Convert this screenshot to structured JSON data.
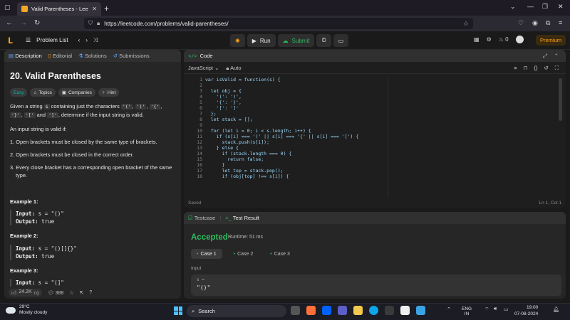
{
  "browser": {
    "tab_title": "Valid Parentheses - LeetCode",
    "url": "https://leetcode.com/problems/valid-parentheses/"
  },
  "header": {
    "problem_list": "Problem List",
    "run": "Run",
    "submit": "Submit",
    "streak_count": "0",
    "premium": "Premium"
  },
  "left_panel": {
    "tabs": [
      "Description",
      "Editorial",
      "Solutions",
      "Submissions"
    ],
    "title": "20. Valid Parentheses",
    "tags": [
      "Easy",
      "Topics",
      "Companies",
      "Hint"
    ],
    "desc_1a": "Given a string ",
    "desc_1_s": "s",
    "desc_1b": " containing just the characters ",
    "chars": [
      "'('",
      "')'",
      "'{'",
      "'}'",
      "'['",
      "']'"
    ],
    "desc_1c": ", determine if the input string is valid.",
    "desc_1_and": " and ",
    "desc_2": "An input string is valid if:",
    "rules": [
      "1. Open brackets must be closed by the same type of brackets.",
      "2. Open brackets must be closed in the correct order.",
      "3. Every close bracket has a corresponding open bracket of the same type."
    ],
    "examples": [
      {
        "heading": "Example 1:",
        "input_label": "Input:",
        "input": " s = \"()\"",
        "output_label": "Output:",
        "output": " true"
      },
      {
        "heading": "Example 2:",
        "input_label": "Input:",
        "input": " s = \"()[]{}\"",
        "output_label": "Output:",
        "output": " true"
      },
      {
        "heading": "Example 3:",
        "input_label": "Input:",
        "input": " s = \"(]\""
      }
    ],
    "likes": "24.2K",
    "comments": "388"
  },
  "code_panel": {
    "title": "Code",
    "language": "JavaScript",
    "mode": "Auto",
    "line_numbers": [
      "1",
      "2",
      "3",
      "4",
      "5",
      "6",
      "7",
      "8",
      "9",
      "10",
      "11",
      "12",
      "13",
      "14",
      "15",
      "16",
      "17",
      "18"
    ],
    "lines": [
      "var isValid = function(s) {",
      "",
      "  let obj = {",
      "    '(': ')',",
      "    '{': '}',",
      "    '[': ']'",
      "  };",
      "  let stack = [];",
      "",
      "  for (let i = 0; i < s.length; i++) {",
      "    if (s[i] === '(' || s[i] === '{' || s[i] === '[') {",
      "      stack.push(s[i]);",
      "    } else {",
      "      if (stack.length === 0) {",
      "        return false;",
      "      }",
      "      let top = stack.pop();",
      "      if (obj[top] !== s[i]) {"
    ],
    "status": "Saved",
    "cursor": "Ln 1, Col 1"
  },
  "test_panel": {
    "tabs": [
      "Testcase",
      "Test Result"
    ],
    "result": "Accepted",
    "runtime": "Runtime: 51 ms",
    "cases": [
      "Case 1",
      "Case 2",
      "Case 3"
    ],
    "input_label": "Input",
    "var_name": "s =",
    "var_value": "\"()\""
  },
  "taskbar": {
    "temp": "29°C",
    "weather": "Mostly cloudy",
    "search": "Search",
    "lang": "ENG",
    "region": "IN",
    "time": "19:00",
    "date": "07-08-2024"
  },
  "colors": {
    "accent": "#ffa116",
    "green": "#2cbb5d",
    "easy": "#00b8a3"
  }
}
